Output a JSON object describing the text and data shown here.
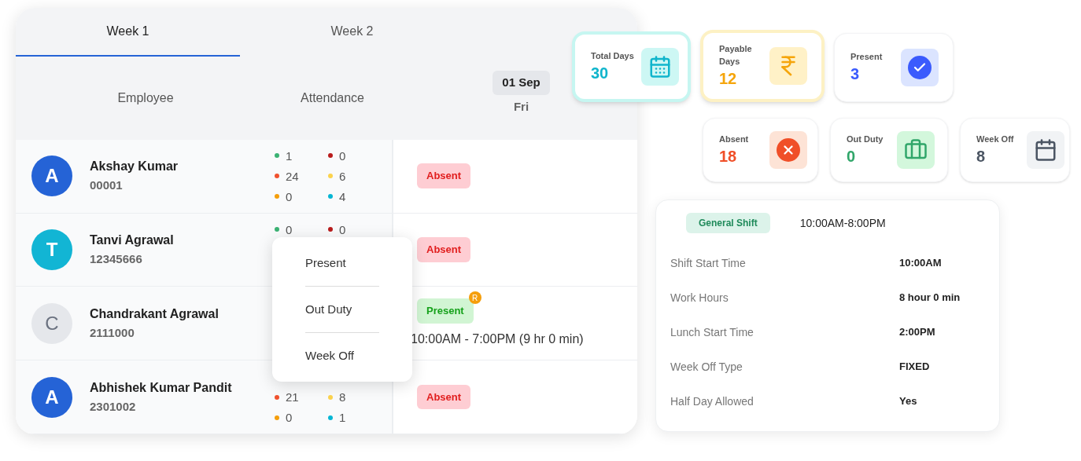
{
  "tabs": [
    {
      "label": "Week 1",
      "selected": true
    },
    {
      "label": "Week 2",
      "selected": false
    }
  ],
  "table": {
    "columns": [
      "Employee",
      "Attendance"
    ],
    "day": {
      "date": "01 Sep",
      "weekday": "Fri"
    },
    "rows": [
      {
        "initial": "A",
        "color": "#2563d6",
        "name": "Akshay Kumar",
        "code": "00001",
        "stats": [
          {
            "value": "1",
            "color": "#3bb273"
          },
          {
            "value": "0",
            "color": "#b91c1c"
          },
          {
            "value": "24",
            "color": "#f0522e"
          },
          {
            "value": "6",
            "color": "#fcd34d"
          },
          {
            "value": "0",
            "color": "#f59e0b"
          },
          {
            "value": "4",
            "color": "#06b6d4"
          }
        ],
        "status": {
          "label": "Absent",
          "kind": "absent"
        }
      },
      {
        "initial": "T",
        "color": "#12b5d4",
        "name": "Tanvi Agrawal",
        "code": "12345666",
        "stats": [
          {
            "value": "0",
            "color": "#3bb273"
          },
          {
            "value": "0",
            "color": "#b91c1c"
          }
        ],
        "status": {
          "label": "Absent",
          "kind": "absent"
        }
      },
      {
        "initial": "C",
        "color": "#e5e7eb",
        "name": "Chandrakant Agrawal",
        "code": "2111000",
        "stats": [],
        "status": {
          "label": "Present",
          "kind": "present",
          "badge": "R",
          "time": "10:00AM - 7:00PM (9 hr 0 min)"
        }
      },
      {
        "initial": "A",
        "color": "#2563d6",
        "name": "Abhishek Kumar Pandit",
        "code": "2301002",
        "stats": [
          {
            "value": "21",
            "color": "#f0522e"
          },
          {
            "value": "8",
            "color": "#fcd34d"
          },
          {
            "value": "0",
            "color": "#f59e0b"
          },
          {
            "value": "1",
            "color": "#06b6d4"
          }
        ],
        "status": {
          "label": "Absent",
          "kind": "absent"
        }
      }
    ]
  },
  "menu": [
    "Present",
    "Out Duty",
    "Week Off"
  ],
  "summary_cards": [
    {
      "label": "Total Days",
      "value": "30",
      "kind": "total",
      "highlighted": true
    },
    {
      "label": "Payable Days",
      "value": "12",
      "kind": "payable",
      "highlighted": true
    },
    {
      "label": "Present",
      "value": "3",
      "kind": "present",
      "highlighted": false
    },
    {
      "label": "Absent",
      "value": "18",
      "kind": "absent",
      "highlighted": false
    },
    {
      "label": "Out Duty",
      "value": "0",
      "kind": "outduty",
      "highlighted": false
    },
    {
      "label": "Week Off",
      "value": "8",
      "kind": "weekoff",
      "highlighted": false
    }
  ],
  "shift": {
    "name": "General Shift",
    "hours": "10:00AM-8:00PM",
    "details": [
      {
        "label": "Shift Start Time",
        "value": "10:00AM"
      },
      {
        "label": "Work Hours",
        "value": "8 hour 0 min"
      },
      {
        "label": "Lunch Start Time",
        "value": "2:00PM"
      },
      {
        "label": "Week Off Type",
        "value": "FIXED"
      },
      {
        "label": "Half Day Allowed",
        "value": "Yes"
      }
    ]
  }
}
